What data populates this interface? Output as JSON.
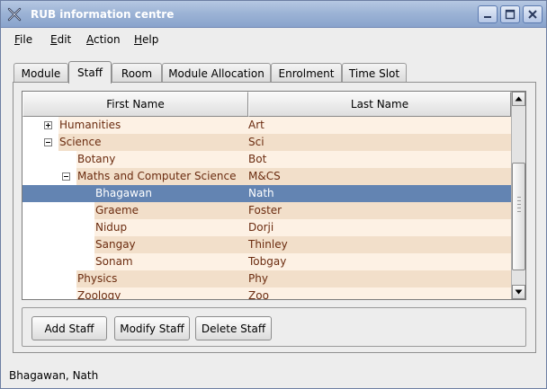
{
  "window": {
    "title": "RUB information centre"
  },
  "menu": {
    "items": [
      {
        "mnemonic": "F",
        "rest": "ile"
      },
      {
        "mnemonic": "E",
        "rest": "dit"
      },
      {
        "mnemonic": "A",
        "rest": "ction"
      },
      {
        "mnemonic": "H",
        "rest": "elp"
      }
    ]
  },
  "tabs": {
    "items": [
      "Module",
      "Staff",
      "Room",
      "Module Allocation",
      "Enrolment",
      "Time Slot"
    ],
    "active": "Staff"
  },
  "table": {
    "headers": [
      "First Name",
      "Last Name"
    ],
    "rows": [
      {
        "first": "Humanities",
        "last": "Art",
        "depth": 0,
        "expander": "plus"
      },
      {
        "first": "Science",
        "last": "Sci",
        "depth": 0,
        "expander": "minus"
      },
      {
        "first": "Botany",
        "last": "Bot",
        "depth": 1
      },
      {
        "first": "Maths and Computer Science",
        "last": "M&CS",
        "depth": 1,
        "expander": "minus"
      },
      {
        "first": "Bhagawan",
        "last": "Nath",
        "depth": 2,
        "selected": true
      },
      {
        "first": "Graeme",
        "last": "Foster",
        "depth": 2
      },
      {
        "first": "Nidup",
        "last": "Dorji",
        "depth": 2
      },
      {
        "first": "Sangay",
        "last": "Thinley",
        "depth": 2
      },
      {
        "first": "Sonam",
        "last": "Tobgay",
        "depth": 2
      },
      {
        "first": "Physics",
        "last": "Phy",
        "depth": 1
      },
      {
        "first": "Zoology",
        "last": "Zoo",
        "depth": 1
      }
    ]
  },
  "buttons": {
    "add": "Add Staff",
    "modify": "Modify Staff",
    "delete": "Delete Staff"
  },
  "status": {
    "text": "Bhagawan, Nath"
  },
  "colors": {
    "row_light": "#fdf1e4",
    "row_dark": "#f2dfca",
    "selection": "#6384b2",
    "text": "#6b2c10"
  }
}
